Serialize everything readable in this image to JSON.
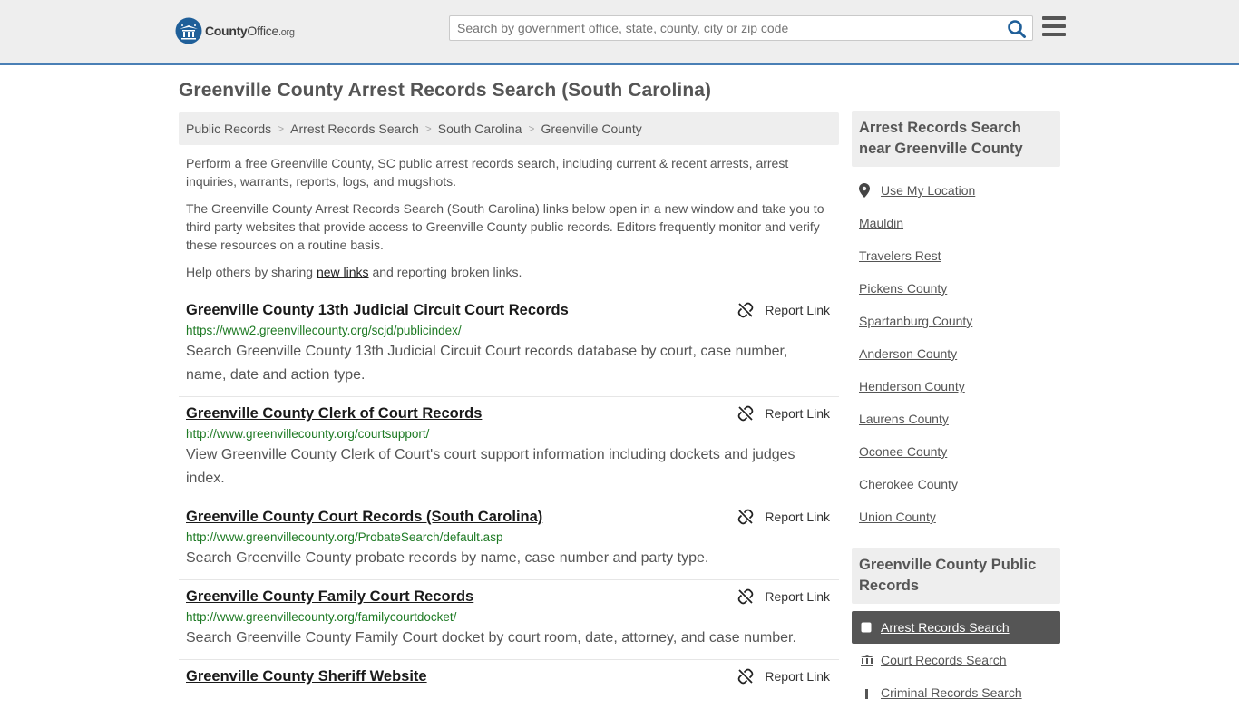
{
  "header": {
    "logo_text_bold": "County",
    "logo_text_normal": "Office",
    "logo_text_suffix": ".org",
    "search_placeholder": "Search by government office, state, county, city or zip code"
  },
  "page": {
    "title": "Greenville County Arrest Records Search (South Carolina)"
  },
  "breadcrumb": [
    "Public Records",
    "Arrest Records Search",
    "South Carolina",
    "Greenville County"
  ],
  "intro": {
    "p1": "Perform a free Greenville County, SC public arrest records search, including current & recent arrests, arrest inquiries, warrants, reports, logs, and mugshots.",
    "p2": "The Greenville County Arrest Records Search (South Carolina) links below open in a new window and take you to third party websites that provide access to Greenville County public records. Editors frequently monitor and verify these resources on a routine basis.",
    "p3_before": "Help others by sharing ",
    "p3_link": "new links",
    "p3_after": " and reporting broken links."
  },
  "report_label": "Report Link",
  "results": [
    {
      "title": "Greenville County 13th Judicial Circuit Court Records",
      "url": "https://www2.greenvillecounty.org/scjd/publicindex/",
      "desc": "Search Greenville County 13th Judicial Circuit Court records database by court, case number, name, date and action type."
    },
    {
      "title": "Greenville County Clerk of Court Records",
      "url": "http://www.greenvillecounty.org/courtsupport/",
      "desc": "View Greenville County Clerk of Court's court support information including dockets and judges index."
    },
    {
      "title": "Greenville County Court Records (South Carolina)",
      "url": "http://www.greenvillecounty.org/ProbateSearch/default.asp",
      "desc": "Search Greenville County probate records by name, case number and party type."
    },
    {
      "title": "Greenville County Family Court Records",
      "url": "http://www.greenvillecounty.org/familycourtdocket/",
      "desc": "Search Greenville County Family Court docket by court room, date, attorney, and case number."
    },
    {
      "title": "Greenville County Sheriff Website",
      "url": "",
      "desc": ""
    }
  ],
  "sidebar": {
    "near_heading": "Arrest Records Search near Greenville County",
    "use_location": "Use My Location",
    "near_links": [
      "Mauldin",
      "Travelers Rest",
      "Pickens County",
      "Spartanburg County",
      "Anderson County",
      "Henderson County",
      "Laurens County",
      "Oconee County",
      "Cherokee County",
      "Union County"
    ],
    "public_heading": "Greenville County Public Records",
    "public_links": [
      {
        "label": "Arrest Records Search",
        "icon": "square-icon",
        "active": true
      },
      {
        "label": "Court Records Search",
        "icon": "courthouse-icon",
        "active": false
      },
      {
        "label": "Criminal Records Search",
        "icon": "criminal-icon",
        "active": false
      }
    ]
  },
  "colors": {
    "accent_border": "#4a7fb5",
    "url_green": "#1e7a24",
    "logo_blue": "#1f5f99"
  }
}
